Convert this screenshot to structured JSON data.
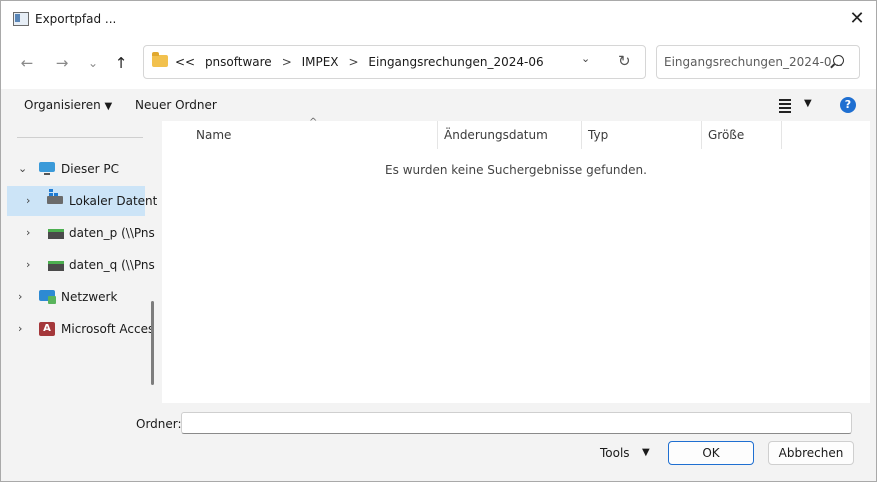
{
  "window": {
    "title": "Exportpfad ..."
  },
  "nav": {
    "back": "←",
    "forward": "→",
    "recent": "⌄",
    "up": "↑"
  },
  "address": {
    "overflow": "<<",
    "crumbs": [
      "pnsoftware",
      "IMPEX",
      "Eingangsrechungen_2024-06"
    ],
    "separator": ">"
  },
  "search": {
    "placeholder": "Eingangsrechungen_2024-0..."
  },
  "commandbar": {
    "organize": "Organisieren",
    "new_folder": "Neuer Ordner"
  },
  "navpane": {
    "items": [
      {
        "label": "Dieser PC",
        "icon": "pc-icon",
        "expanded": true
      },
      {
        "label": "Lokaler Datent",
        "icon": "drive-icon",
        "selected": true
      },
      {
        "label": "daten_p (\\\\Pns",
        "icon": "network-drive-icon"
      },
      {
        "label": "daten_q (\\\\Pns",
        "icon": "network-drive-icon"
      },
      {
        "label": "Netzwerk",
        "icon": "network-icon"
      },
      {
        "label": "Microsoft Acces",
        "icon": "access-icon",
        "icon_text": "A"
      }
    ]
  },
  "columns": {
    "name": "Name",
    "modified": "Änderungsdatum",
    "type": "Typ",
    "size": "Größe"
  },
  "content": {
    "empty_message": "Es wurden keine Suchergebnisse gefunden."
  },
  "footer": {
    "folder_label": "Ordner:",
    "folder_value": "",
    "tools": "Tools",
    "ok": "OK",
    "cancel": "Abbrechen"
  },
  "colors": {
    "accent": "#1f6fd1",
    "selection": "#cce4f7",
    "access_red": "#a4373a"
  }
}
